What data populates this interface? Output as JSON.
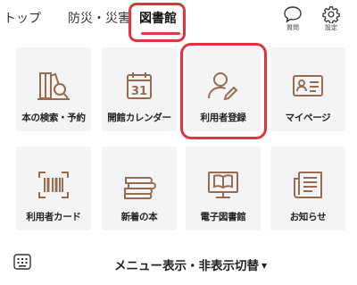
{
  "tabs": [
    {
      "label": "トップ"
    },
    {
      "label": "防災・災害"
    },
    {
      "label": "図書館"
    }
  ],
  "header_icons": {
    "question_label": "質問",
    "settings_label": "設定"
  },
  "menu_items": [
    {
      "label": "本の検索・予約",
      "icon": "book-search-icon"
    },
    {
      "label": "開館カレンダー",
      "icon": "calendar-31-icon"
    },
    {
      "label": "利用者登録",
      "icon": "user-edit-icon"
    },
    {
      "label": "マイページ",
      "icon": "id-card-icon"
    },
    {
      "label": "利用者カード",
      "icon": "barcode-scan-icon"
    },
    {
      "label": "新着の本",
      "icon": "book-stack-icon"
    },
    {
      "label": "電子図書館",
      "icon": "monitor-book-icon"
    },
    {
      "label": "お知らせ",
      "icon": "newspaper-icon"
    }
  ],
  "calendar_day": "31",
  "footer": {
    "menu_toggle_label": "メニュー表示・非表示切替"
  },
  "colors": {
    "icon_brown": "#9a6b4f",
    "highlight_red": "#e6323f",
    "tile_bg": "#f3f4f6"
  }
}
